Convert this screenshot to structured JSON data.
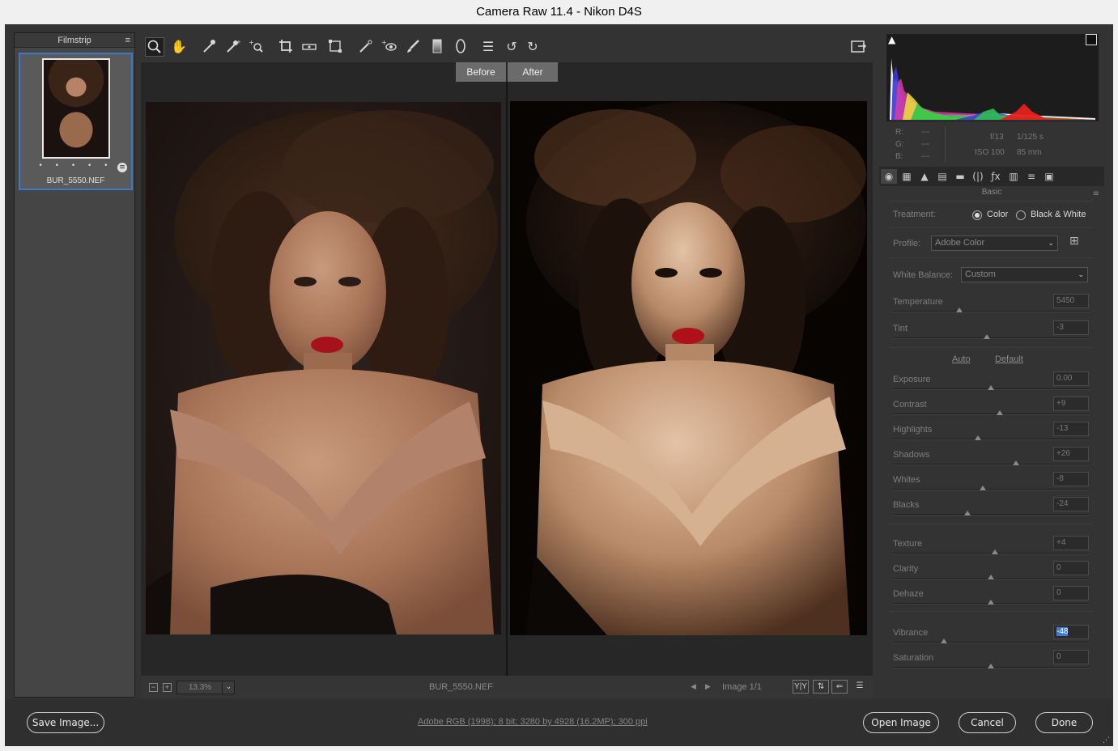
{
  "window": {
    "title": "Camera Raw 11.4  -  Nikon D4S"
  },
  "filmstrip": {
    "title": "Filmstrip",
    "file_name": "BUR_5550.NEF",
    "rating_dots": "• • • • •"
  },
  "toolbar": {
    "tools": [
      "zoom-tool",
      "hand-tool",
      "white-balance-tool",
      "color-sampler-tool",
      "targeted-adjustment-tool",
      "crop-tool",
      "straighten-tool",
      "transform-tool",
      "spot-removal-tool",
      "red-eye-tool",
      "adjustment-brush-tool",
      "graduated-filter-tool",
      "radial-filter-tool",
      "preferences-tool",
      "rotate-ccw-tool",
      "rotate-cw-tool"
    ],
    "fullscreen": "toggle-fullscreen"
  },
  "preview": {
    "before_label": "Before",
    "after_label": "After"
  },
  "preview_footer": {
    "zoom": "13.3%",
    "file_name": "BUR_5550.NEF",
    "image_count": "Image 1/1",
    "zoom_out": "−",
    "zoom_in": "+"
  },
  "info": {
    "r_label": "R:",
    "g_label": "G:",
    "b_label": "B:",
    "r_value": "---",
    "g_value": "---",
    "b_value": "---",
    "aperture": "f/13",
    "shutter": "1/125 s",
    "iso": "ISO 100",
    "focal": "85 mm"
  },
  "panel": {
    "title": "Basic"
  },
  "basic": {
    "treatment_label": "Treatment:",
    "color_label": "Color",
    "bw_label": "Black & White",
    "profile_label": "Profile:",
    "profile_value": "Adobe Color",
    "wb_label": "White Balance:",
    "wb_value": "Custom",
    "auto_label": "Auto",
    "default_label": "Default",
    "sliders": [
      {
        "name": "Temperature",
        "value": "5450",
        "pos": 0.34
      },
      {
        "name": "Tint",
        "value": "-3",
        "pos": 0.48
      },
      {
        "name": "Exposure",
        "value": "0.00",
        "pos": 0.5
      },
      {
        "name": "Contrast",
        "value": "+9",
        "pos": 0.545
      },
      {
        "name": "Highlights",
        "value": "-13",
        "pos": 0.435
      },
      {
        "name": "Shadows",
        "value": "+26",
        "pos": 0.63
      },
      {
        "name": "Whites",
        "value": "-8",
        "pos": 0.46
      },
      {
        "name": "Blacks",
        "value": "-24",
        "pos": 0.38
      },
      {
        "name": "Texture",
        "value": "+4",
        "pos": 0.52
      },
      {
        "name": "Clarity",
        "value": "0",
        "pos": 0.5
      },
      {
        "name": "Dehaze",
        "value": "0",
        "pos": 0.5
      },
      {
        "name": "Vibrance",
        "value": "-48",
        "pos": 0.26
      },
      {
        "name": "Saturation",
        "value": "0",
        "pos": 0.5
      }
    ]
  },
  "footer": {
    "save_label": "Save Image...",
    "info_link": "Adobe RGB (1998); 8 bit; 3280 by 4928 (16.2MP); 300 ppi",
    "open_label": "Open Image",
    "cancel_label": "Cancel",
    "done_label": "Done"
  }
}
